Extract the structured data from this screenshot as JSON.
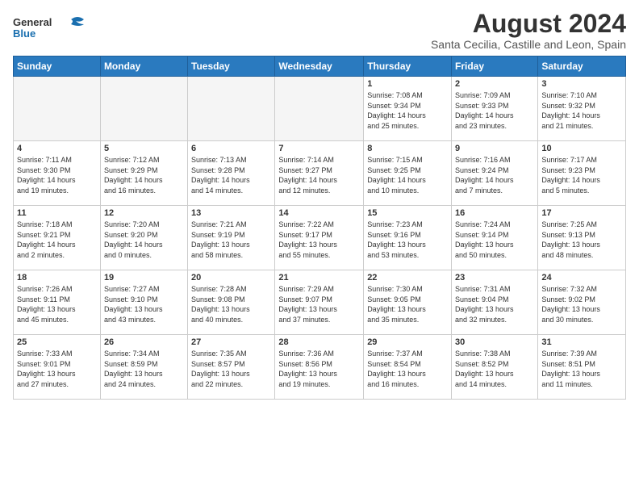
{
  "header": {
    "logo_general": "General",
    "logo_blue": "Blue",
    "month_year": "August 2024",
    "location": "Santa Cecilia, Castille and Leon, Spain"
  },
  "weekdays": [
    "Sunday",
    "Monday",
    "Tuesday",
    "Wednesday",
    "Thursday",
    "Friday",
    "Saturday"
  ],
  "weeks": [
    [
      {
        "day": "",
        "info": ""
      },
      {
        "day": "",
        "info": ""
      },
      {
        "day": "",
        "info": ""
      },
      {
        "day": "",
        "info": ""
      },
      {
        "day": "1",
        "info": "Sunrise: 7:08 AM\nSunset: 9:34 PM\nDaylight: 14 hours\nand 25 minutes."
      },
      {
        "day": "2",
        "info": "Sunrise: 7:09 AM\nSunset: 9:33 PM\nDaylight: 14 hours\nand 23 minutes."
      },
      {
        "day": "3",
        "info": "Sunrise: 7:10 AM\nSunset: 9:32 PM\nDaylight: 14 hours\nand 21 minutes."
      }
    ],
    [
      {
        "day": "4",
        "info": "Sunrise: 7:11 AM\nSunset: 9:30 PM\nDaylight: 14 hours\nand 19 minutes."
      },
      {
        "day": "5",
        "info": "Sunrise: 7:12 AM\nSunset: 9:29 PM\nDaylight: 14 hours\nand 16 minutes."
      },
      {
        "day": "6",
        "info": "Sunrise: 7:13 AM\nSunset: 9:28 PM\nDaylight: 14 hours\nand 14 minutes."
      },
      {
        "day": "7",
        "info": "Sunrise: 7:14 AM\nSunset: 9:27 PM\nDaylight: 14 hours\nand 12 minutes."
      },
      {
        "day": "8",
        "info": "Sunrise: 7:15 AM\nSunset: 9:25 PM\nDaylight: 14 hours\nand 10 minutes."
      },
      {
        "day": "9",
        "info": "Sunrise: 7:16 AM\nSunset: 9:24 PM\nDaylight: 14 hours\nand 7 minutes."
      },
      {
        "day": "10",
        "info": "Sunrise: 7:17 AM\nSunset: 9:23 PM\nDaylight: 14 hours\nand 5 minutes."
      }
    ],
    [
      {
        "day": "11",
        "info": "Sunrise: 7:18 AM\nSunset: 9:21 PM\nDaylight: 14 hours\nand 2 minutes."
      },
      {
        "day": "12",
        "info": "Sunrise: 7:20 AM\nSunset: 9:20 PM\nDaylight: 14 hours\nand 0 minutes."
      },
      {
        "day": "13",
        "info": "Sunrise: 7:21 AM\nSunset: 9:19 PM\nDaylight: 13 hours\nand 58 minutes."
      },
      {
        "day": "14",
        "info": "Sunrise: 7:22 AM\nSunset: 9:17 PM\nDaylight: 13 hours\nand 55 minutes."
      },
      {
        "day": "15",
        "info": "Sunrise: 7:23 AM\nSunset: 9:16 PM\nDaylight: 13 hours\nand 53 minutes."
      },
      {
        "day": "16",
        "info": "Sunrise: 7:24 AM\nSunset: 9:14 PM\nDaylight: 13 hours\nand 50 minutes."
      },
      {
        "day": "17",
        "info": "Sunrise: 7:25 AM\nSunset: 9:13 PM\nDaylight: 13 hours\nand 48 minutes."
      }
    ],
    [
      {
        "day": "18",
        "info": "Sunrise: 7:26 AM\nSunset: 9:11 PM\nDaylight: 13 hours\nand 45 minutes."
      },
      {
        "day": "19",
        "info": "Sunrise: 7:27 AM\nSunset: 9:10 PM\nDaylight: 13 hours\nand 43 minutes."
      },
      {
        "day": "20",
        "info": "Sunrise: 7:28 AM\nSunset: 9:08 PM\nDaylight: 13 hours\nand 40 minutes."
      },
      {
        "day": "21",
        "info": "Sunrise: 7:29 AM\nSunset: 9:07 PM\nDaylight: 13 hours\nand 37 minutes."
      },
      {
        "day": "22",
        "info": "Sunrise: 7:30 AM\nSunset: 9:05 PM\nDaylight: 13 hours\nand 35 minutes."
      },
      {
        "day": "23",
        "info": "Sunrise: 7:31 AM\nSunset: 9:04 PM\nDaylight: 13 hours\nand 32 minutes."
      },
      {
        "day": "24",
        "info": "Sunrise: 7:32 AM\nSunset: 9:02 PM\nDaylight: 13 hours\nand 30 minutes."
      }
    ],
    [
      {
        "day": "25",
        "info": "Sunrise: 7:33 AM\nSunset: 9:01 PM\nDaylight: 13 hours\nand 27 minutes."
      },
      {
        "day": "26",
        "info": "Sunrise: 7:34 AM\nSunset: 8:59 PM\nDaylight: 13 hours\nand 24 minutes."
      },
      {
        "day": "27",
        "info": "Sunrise: 7:35 AM\nSunset: 8:57 PM\nDaylight: 13 hours\nand 22 minutes."
      },
      {
        "day": "28",
        "info": "Sunrise: 7:36 AM\nSunset: 8:56 PM\nDaylight: 13 hours\nand 19 minutes."
      },
      {
        "day": "29",
        "info": "Sunrise: 7:37 AM\nSunset: 8:54 PM\nDaylight: 13 hours\nand 16 minutes."
      },
      {
        "day": "30",
        "info": "Sunrise: 7:38 AM\nSunset: 8:52 PM\nDaylight: 13 hours\nand 14 minutes."
      },
      {
        "day": "31",
        "info": "Sunrise: 7:39 AM\nSunset: 8:51 PM\nDaylight: 13 hours\nand 11 minutes."
      }
    ]
  ]
}
